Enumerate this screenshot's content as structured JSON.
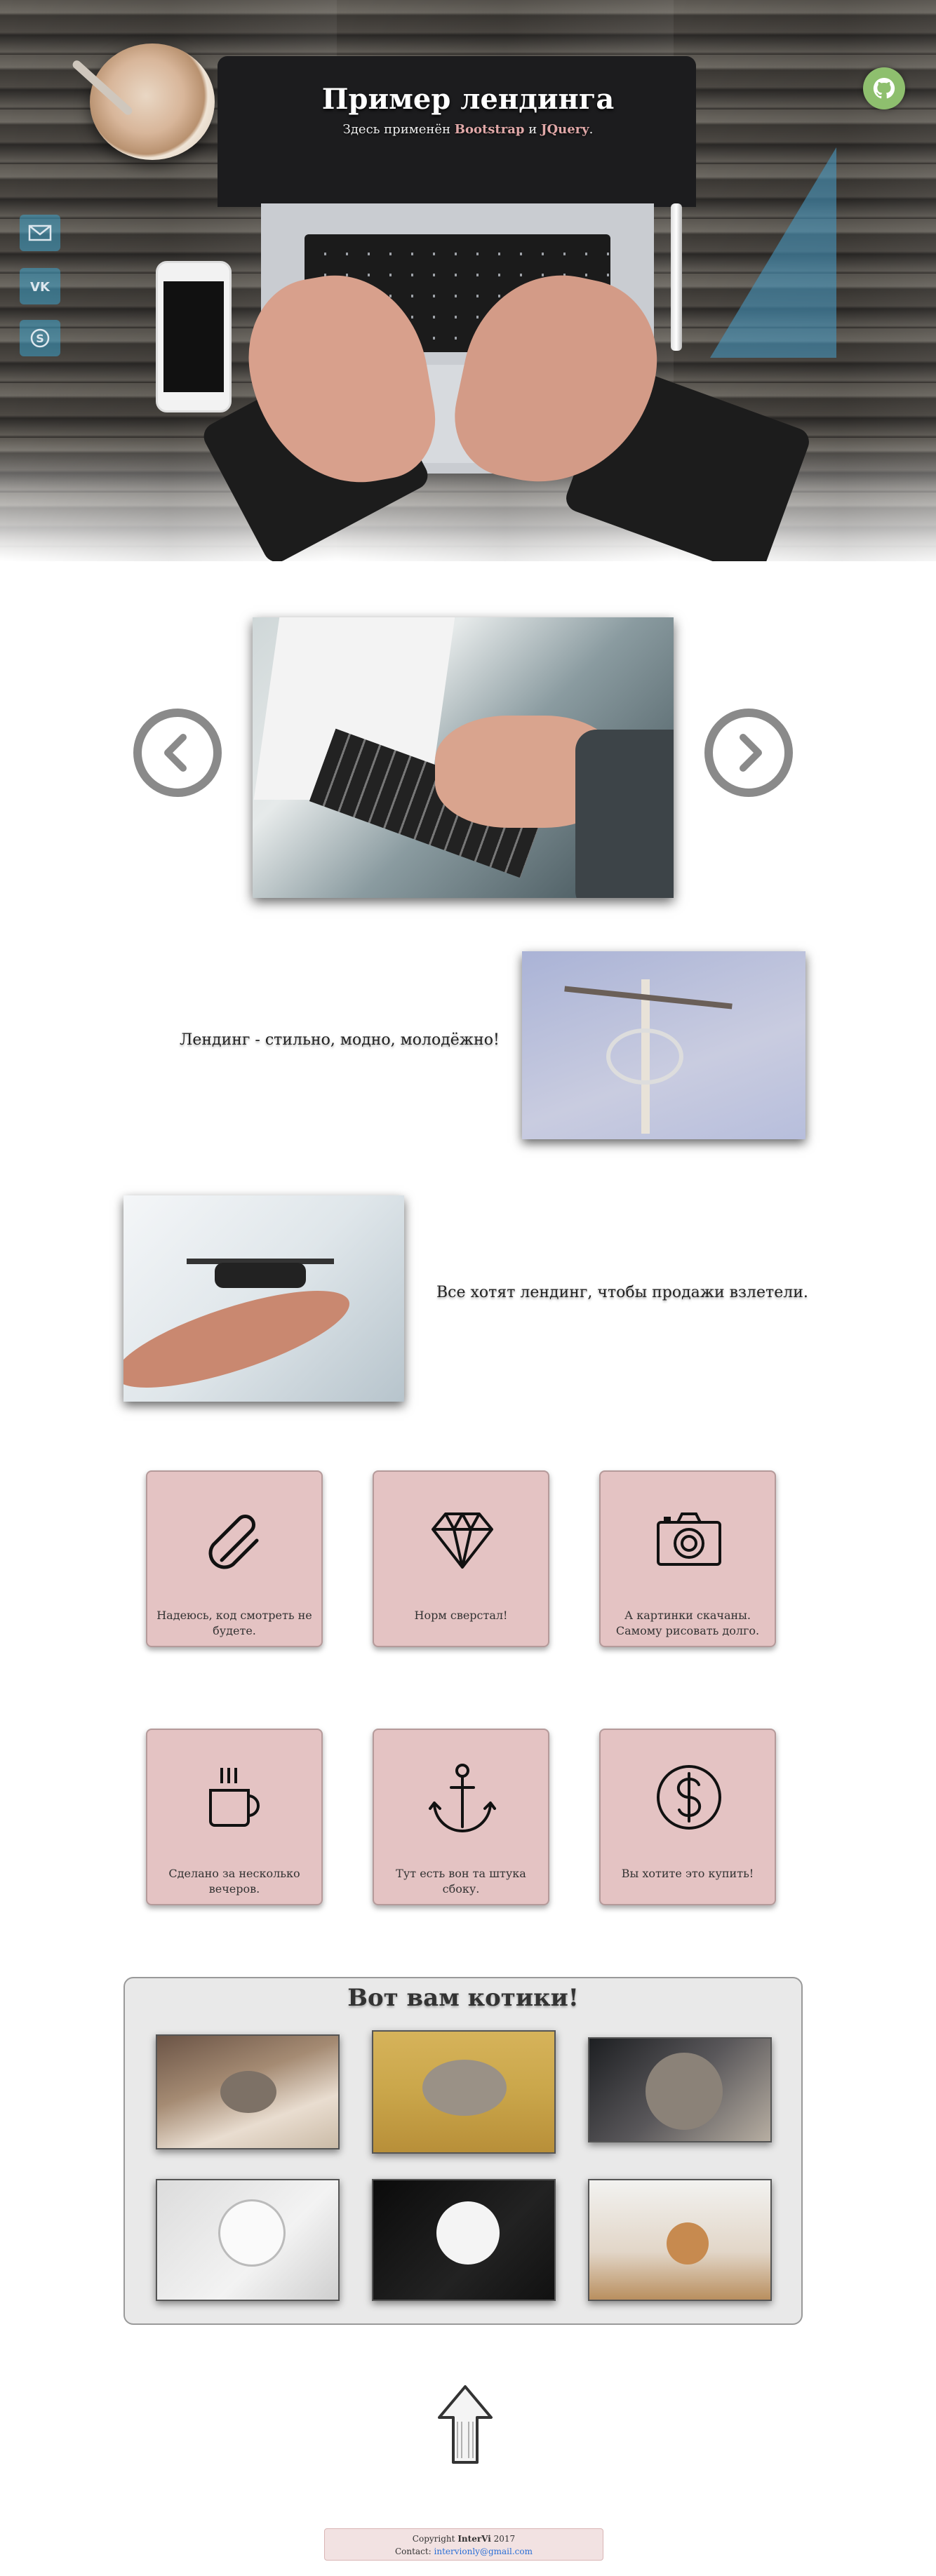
{
  "hero": {
    "title": "Пример лендинга",
    "subtitle_pre": "Здесь применён",
    "subtitle_bootstrap": "Bootstrap",
    "subtitle_and": "и",
    "subtitle_jquery": "JQuery",
    "subtitle_end": "."
  },
  "social": [
    {
      "icon": "mail-icon"
    },
    {
      "icon": "vk-icon"
    },
    {
      "icon": "skype-icon"
    }
  ],
  "github_icon": "github-icon",
  "features": {
    "row1_text": "Лендинг - стильно, модно, молодёжно!",
    "row2_text": "Все хотят лендинг, чтобы продажи взлетели."
  },
  "tiles": [
    {
      "icon": "paperclip-icon",
      "caption": "Надеюсь, код смотреть не будете."
    },
    {
      "icon": "diamond-icon",
      "caption": "Норм сверстал!"
    },
    {
      "icon": "camera-icon",
      "caption": "А картинки скачаны. Самому рисовать долго."
    },
    {
      "icon": "coffee-cup-icon",
      "caption": "Сделано за несколько вечеров."
    },
    {
      "icon": "anchor-icon",
      "caption": "Тут есть вон та штука сбоку."
    },
    {
      "icon": "dollar-icon",
      "caption": "Вы хотите это купить!"
    }
  ],
  "cats": {
    "title": "Вот вам котики!"
  },
  "footer": {
    "copyright_pre": "Copyright",
    "brand": "InterVi",
    "year": "2017",
    "contact_label": "Contact:",
    "email": "intervionly@gmail.com"
  },
  "colors": {
    "tile_bg": "#e4c3c3",
    "accent_link": "#2a6fd6",
    "github_bg": "#8ebf6e",
    "highlight": "#e0a8a8"
  }
}
